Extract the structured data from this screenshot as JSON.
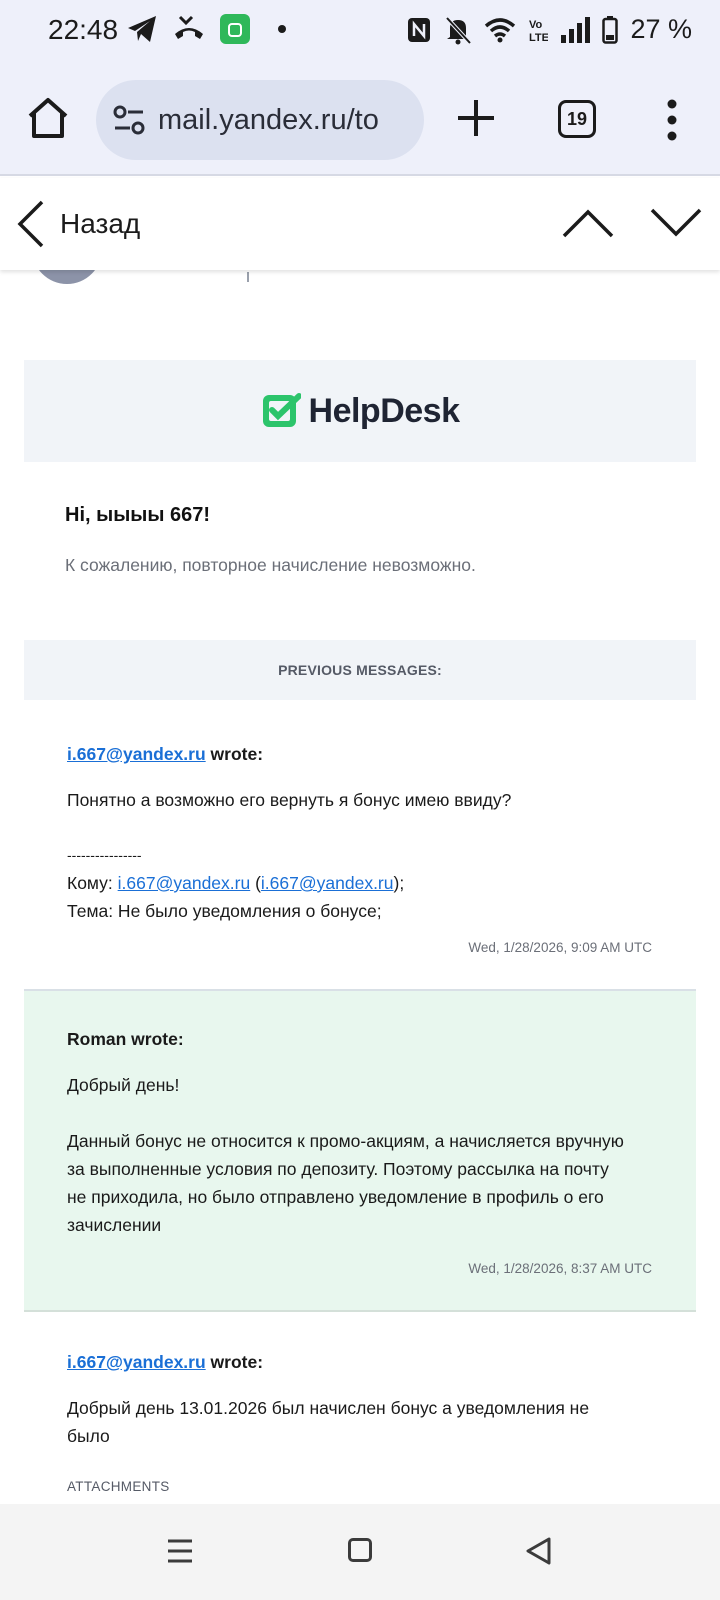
{
  "status": {
    "time": "22:48",
    "battery": "27 %",
    "left_icons": [
      "telegram-icon",
      "missed-call-icon",
      "app-store-icon",
      "dot-icon"
    ],
    "right_icons": [
      "nfc-icon",
      "bell-off-icon",
      "wifi-icon",
      "volte-icon",
      "signal-icon",
      "battery-icon"
    ]
  },
  "browser": {
    "url": "mail.yandex.ru/to",
    "tabs_count": "19"
  },
  "mail_header": {
    "back_label": "Назад"
  },
  "email": {
    "logo_text": "HelpDesk",
    "greeting": "Hi, ыыыы 667!",
    "intro": "К сожалению, повторное начисление невозможно.",
    "previous_label": "PREVIOUS MESSAGES:",
    "messages": [
      {
        "author_link": "i.667@yandex.ru",
        "author_suffix": " wrote:",
        "body": "Понятно а возможно его вернуть я бонус имею ввиду?",
        "separator": "----------------",
        "to_label": "Кому: ",
        "to_link1": "i.667@yandex.ru",
        "to_link2": "i.667@yandex.ru",
        "subject_line": "Тема: Не было уведомления о бонусе;",
        "date": "Wed, 1/28/2026, 9:09 AM UTC"
      },
      {
        "author": "Roman wrote:",
        "body_line1": "Добрый день!",
        "body_para": "Данный бонус не относится к промо-акциям, а начисляется вручную за выполненные условия по депозиту. Поэтому рассылка на почту не приходила, но было отправлено уведомление в профиль о его зачислении",
        "date": "Wed, 1/28/2026, 8:37 AM UTC"
      },
      {
        "author_link": "i.667@yandex.ru",
        "author_suffix": " wrote:",
        "body": "Добрый день 13.01.2026 был начислен бонус а уведомления не было",
        "attachments_label": "ATTACHMENTS"
      }
    ]
  },
  "colors": {
    "link": "#1a6fd6",
    "helpdesk_green": "#2cc46b",
    "reply_bg": "#e8f7ee"
  }
}
